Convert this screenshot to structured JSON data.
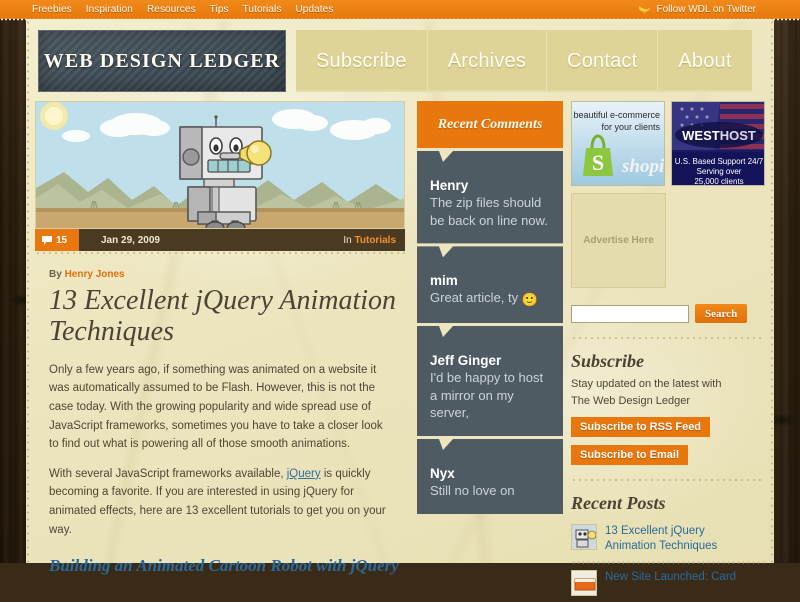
{
  "topbar": {
    "links": [
      {
        "label": "Freebies"
      },
      {
        "label": "Inspiration"
      },
      {
        "label": "Resources"
      },
      {
        "label": "Tips"
      },
      {
        "label": "Tutorials"
      },
      {
        "label": "Updates"
      }
    ],
    "twitter_label": "Follow WDL on Twitter",
    "twitter_icon": "bird-icon",
    "bg_color": "#e8780d"
  },
  "masthead": {
    "logo_text": "WEB DESIGN LEDGER",
    "nav": [
      {
        "label": "Subscribe"
      },
      {
        "label": "Archives"
      },
      {
        "label": "Contact"
      },
      {
        "label": "About"
      }
    ]
  },
  "article": {
    "hero_alt": "cartoon-robot-illustration",
    "comment_count": "15",
    "comment_icon": "speech-bubble-icon",
    "date": "Jan 29, 2009",
    "category_prefix": "In",
    "category": "Tutorials",
    "byline_prefix": "By",
    "author": "Henry Jones",
    "title": "13 Excellent jQuery Animation Techniques",
    "paragraph1_a": "Only a few years ago, if something was animated on a website it was automatically assumed to be Flash. However, this is not the case today. With the growing popularity and wide spread use of JavaScript frameworks, sometimes you have to take a closer look to find out what is powering all of those smooth animations.",
    "paragraph2_a": "With several JavaScript frameworks available, ",
    "paragraph2_link": "jQuery",
    "paragraph2_b": " is quickly becoming a favorite. If you are interested in using jQuery for animated effects, here are 13 excellent tutorials to get you on your way.",
    "subheading": "Building an Animated Cartoon Robot with jQuery"
  },
  "comments": {
    "heading": "Recent Comments",
    "items": [
      {
        "name": "Henry",
        "text": "The zip files should be back on line now."
      },
      {
        "name": "mim",
        "text": "Great article, ty",
        "emoji": "🙂"
      },
      {
        "name": "Jeff Ginger",
        "text": "I'd be happy to host a mirror on my server,"
      },
      {
        "name": "Nyx",
        "text": "Still no love on"
      }
    ]
  },
  "sidebar": {
    "ads": [
      {
        "name": "shopify-ad",
        "line1": "beautiful e-commerce",
        "line2": "for your clients",
        "brand": "shopify"
      },
      {
        "name": "westhost-ad",
        "brand_a": "WEST",
        "brand_b": "HOST",
        "line1": "U.S. Based Support 24/7",
        "line2": "Serving over",
        "line3": "25,000 clients"
      }
    ],
    "advertise_here": "Advertise Here",
    "search": {
      "value": "",
      "placeholder": "",
      "button_label": "Search"
    },
    "subscribe": {
      "title": "Subscribe",
      "description": "Stay updated on the latest with The Web Design Ledger",
      "rss_label": "Subscribe to RSS Feed",
      "email_label": "Subscribe to Email"
    },
    "recent_posts": {
      "title": "Recent Posts",
      "items": [
        {
          "title": "13 Excellent jQuery Animation Techniques",
          "thumb": "robot-thumb-icon"
        },
        {
          "title": "New Site Launched: Card",
          "thumb": "card-thumb-icon"
        }
      ]
    }
  },
  "colors": {
    "orange": "#e8780d",
    "paper": "#ece5bf",
    "slate": "#4e5b63",
    "link_blue": "#2a6a9b",
    "wood": "#34240f"
  }
}
